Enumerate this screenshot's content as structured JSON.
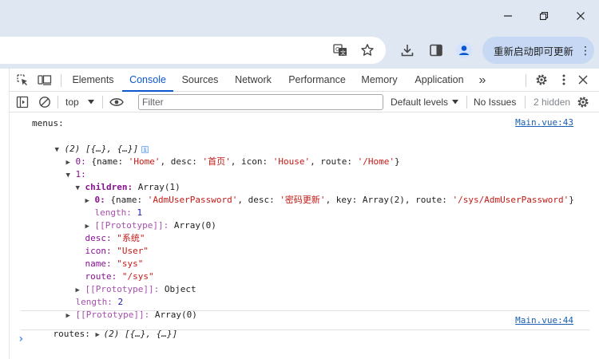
{
  "browser": {
    "update_button": "重新启动即可更新",
    "update_more": "⋮"
  },
  "devtools": {
    "tabs": [
      "Elements",
      "Console",
      "Sources",
      "Network",
      "Performance",
      "Memory",
      "Application"
    ],
    "active_tab": "Console",
    "more_tabs": "»",
    "filterbar": {
      "context": "top",
      "filter_placeholder": "Filter",
      "levels": "Default levels",
      "issues": "No Issues",
      "hidden": "2 hidden"
    }
  },
  "console": {
    "menus_label": "menus:",
    "menus_source": "Main.vue:43",
    "menus_summary": "(2) [{…}, {…}]",
    "item0_key": "0:",
    "item0_text_a": "{name: ",
    "item0_name": "'Home'",
    "item0_text_b": ", desc: ",
    "item0_desc": "'首页'",
    "item0_text_c": ", icon: ",
    "item0_icon": "'House'",
    "item0_text_d": ", route: ",
    "item0_route": "'/Home'",
    "item0_text_e": "}",
    "item1_key": "1:",
    "children_key": "children:",
    "children_val": "Array(1)",
    "child0_key": "0:",
    "child0_text_a": "{name: ",
    "child0_name": "'AdmUserPassword'",
    "child0_text_b": ", desc: ",
    "child0_desc": "'密码更新'",
    "child0_text_c": ", key: ",
    "child0_key_val": "Array(2)",
    "child0_text_d": ", route: ",
    "child0_route": "'/sys/AdmUserPassword'",
    "child0_text_e": "}",
    "children_length_key": "length:",
    "children_length_val": "1",
    "children_proto_key": "[[Prototype]]:",
    "children_proto_val": "Array(0)",
    "desc_key": "desc:",
    "desc_val": "\"系统\"",
    "icon_key": "icon:",
    "icon_val": "\"User\"",
    "name_key": "name:",
    "name_val": "\"sys\"",
    "route_key": "route:",
    "route_val": "\"/sys\"",
    "obj_proto_key": "[[Prototype]]:",
    "obj_proto_val": "Object",
    "length_key": "length:",
    "length_val": "2",
    "arr_proto_key": "[[Prototype]]:",
    "arr_proto_val": "Array(0)",
    "routes_label": "routes:",
    "routes_summary": "(2) [{…}, {…}]",
    "routes_source": "Main.vue:44",
    "prompt": "›"
  }
}
